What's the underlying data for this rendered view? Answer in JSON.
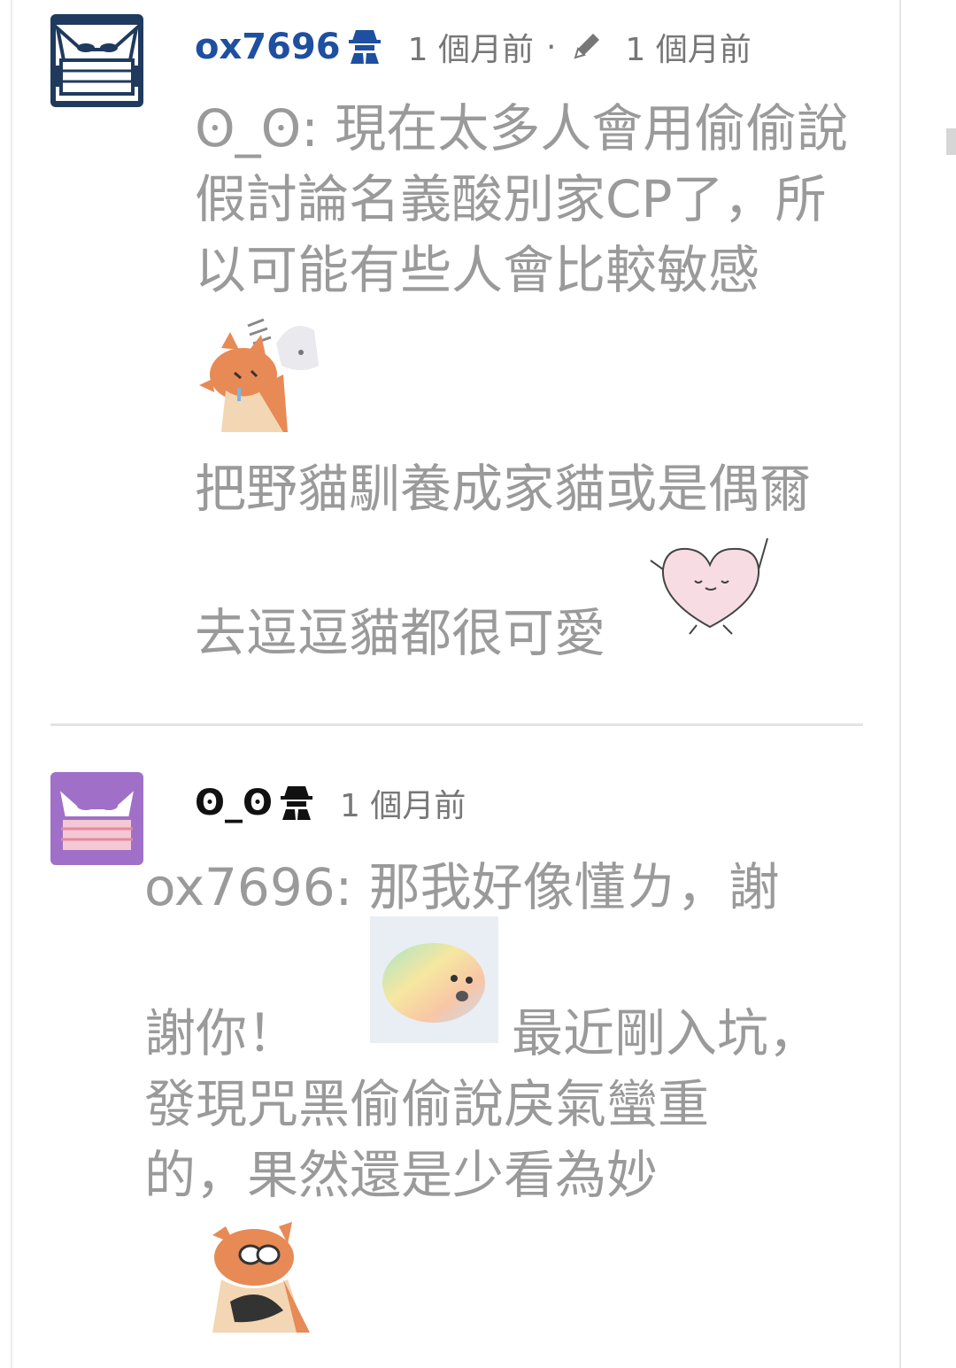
{
  "comments": [
    {
      "author": "ox7696",
      "time": "1 個月前",
      "separator": "·",
      "edited_time": "1 個月前",
      "text_lines": [
        "ʘ_ʘ: 現在太多人會用偷偷說",
        "假討論名義酸別家CP了，所",
        "以可能有些人會比較敏感"
      ],
      "after_sticker_lines": [
        "把野貓馴養成家貓或是偶爾",
        "去逗逗貓都很可愛"
      ],
      "author_color": "#1e4fa0",
      "avatar_color": "#203a5e"
    },
    {
      "author": "ʘ_ʘ",
      "time": "1 個月前",
      "line1": "ox7696: 那我好像懂ㄌ，謝",
      "line2a": "謝你！",
      "line2b": "最近剛入坑，",
      "line3": "發現咒黑偷偷說戾氣蠻重",
      "line4": "的，果然還是少看為妙",
      "avatar_color": "#a070c8"
    }
  ],
  "icons": [
    "spy-icon",
    "pencil-icon",
    "mask-avatar-icon"
  ]
}
